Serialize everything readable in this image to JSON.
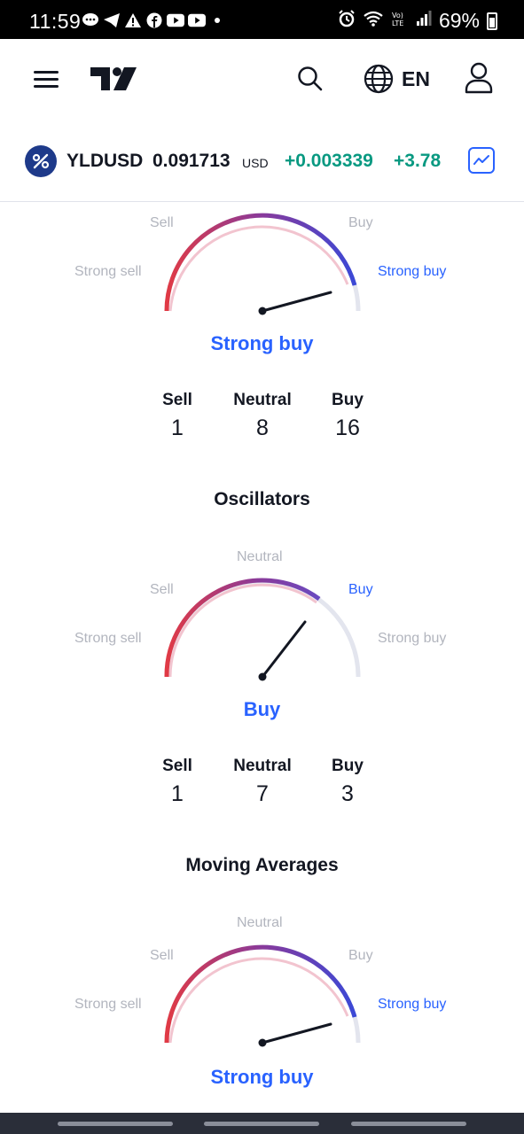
{
  "status_bar": {
    "time": "11:59",
    "battery": "69%"
  },
  "nav": {
    "language": "EN"
  },
  "symbol": {
    "name": "YLDUSD",
    "price": "0.091713",
    "currency": "USD",
    "change": "+0.003339",
    "change_percent": "+3.78"
  },
  "gauge_labels": {
    "strong_sell": "Strong sell",
    "sell": "Sell",
    "neutral": "Neutral",
    "buy": "Buy",
    "strong_buy": "Strong buy"
  },
  "summary": {
    "result": "Strong buy",
    "counts": {
      "sell_label": "Sell",
      "sell": "1",
      "neutral_label": "Neutral",
      "neutral": "8",
      "buy_label": "Buy",
      "buy": "16"
    }
  },
  "oscillators": {
    "title": "Oscillators",
    "result": "Buy",
    "counts": {
      "sell_label": "Sell",
      "sell": "1",
      "neutral_label": "Neutral",
      "neutral": "7",
      "buy_label": "Buy",
      "buy": "3"
    }
  },
  "moving_averages": {
    "title": "Moving Averages",
    "result": "Strong buy"
  },
  "colors": {
    "accent": "#2962ff",
    "positive": "#089981",
    "text": "#131722",
    "muted": "#b2b5be"
  }
}
